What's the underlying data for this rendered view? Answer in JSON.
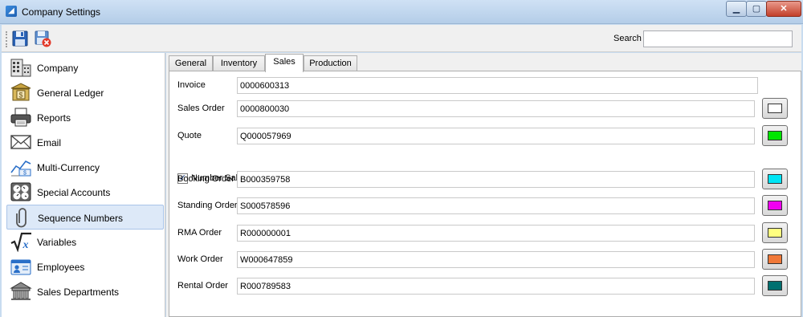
{
  "window": {
    "title": "Company Settings",
    "app_icon_glyph": "◢"
  },
  "window_controls": {
    "minimize": "▁",
    "maximize": "▢",
    "close": "✕"
  },
  "toolbar": {
    "save_icon": "save-icon",
    "discard_icon": "save-cancel-icon",
    "search_label": "Search",
    "search_value": ""
  },
  "nav": {
    "items": [
      {
        "label": "Company",
        "icon": "building-icon"
      },
      {
        "label": "General Ledger",
        "icon": "ledger-icon"
      },
      {
        "label": "Reports",
        "icon": "printer-icon"
      },
      {
        "label": "Email",
        "icon": "envelope-icon"
      },
      {
        "label": "Multi-Currency",
        "icon": "currency-chart-icon"
      },
      {
        "label": "Special Accounts",
        "icon": "gauges-icon"
      },
      {
        "label": "Sequence Numbers",
        "icon": "paperclip-icon"
      },
      {
        "label": "Variables",
        "icon": "sqrt-x-icon"
      },
      {
        "label": "Employees",
        "icon": "id-card-icon"
      },
      {
        "label": "Sales Departments",
        "icon": "store-icon"
      }
    ],
    "active": "Sequence Numbers"
  },
  "tabs": [
    {
      "label": "General"
    },
    {
      "label": "Inventory"
    },
    {
      "label": "Sales"
    },
    {
      "label": "Production"
    }
  ],
  "active_tab": "Sales",
  "sales": {
    "invoice": {
      "label": "Invoice",
      "value": "0000600313"
    },
    "sales_order": {
      "label": "Sales Order",
      "value": "0000800030",
      "color": "#ffffff"
    },
    "quote": {
      "label": "Quote",
      "value": "Q000057969",
      "color": "#00e600"
    },
    "number_by_type": {
      "label": "Number Sales Orders by Type",
      "checked": true,
      "check_glyph": "✓"
    },
    "booking_order": {
      "label": "Booking Order",
      "value": "B000359758",
      "color": "#00e5f5"
    },
    "standing_order": {
      "label": "Standing Order",
      "value": "S000578596",
      "color": "#f000f0"
    },
    "rma_order": {
      "label": "RMA Order",
      "value": "R000000001",
      "color": "#ffff80"
    },
    "work_order": {
      "label": "Work Order",
      "value": "W000647859",
      "color": "#f07838"
    },
    "rental_order": {
      "label": "Rental Order",
      "value": "R000789583",
      "color": "#007070"
    }
  }
}
